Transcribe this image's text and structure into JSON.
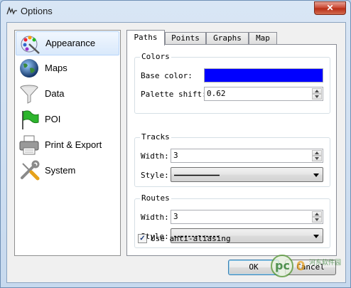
{
  "window": {
    "title": "Options",
    "close_label": "✕"
  },
  "sidebar": {
    "items": [
      {
        "label": "Appearance",
        "icon": "paint-palette-icon",
        "selected": true
      },
      {
        "label": "Maps",
        "icon": "globe-icon",
        "selected": false
      },
      {
        "label": "Data",
        "icon": "funnel-icon",
        "selected": false
      },
      {
        "label": "POI",
        "icon": "green-flag-icon",
        "selected": false
      },
      {
        "label": "Print & Export",
        "icon": "printer-icon",
        "selected": false
      },
      {
        "label": "System",
        "icon": "wrench-screwdriver-icon",
        "selected": false
      }
    ]
  },
  "tabs": [
    {
      "label": "Paths",
      "active": true
    },
    {
      "label": "Points",
      "active": false
    },
    {
      "label": "Graphs",
      "active": false
    },
    {
      "label": "Map",
      "active": false
    }
  ],
  "colors_group": {
    "title": "Colors",
    "base_color_label": "Base color:",
    "base_color_value": "#0000ff",
    "palette_shift_label": "Palette shift:",
    "palette_shift_value": "0.62"
  },
  "tracks_group": {
    "title": "Tracks",
    "width_label": "Width:",
    "width_value": "3",
    "style_label": "Style:",
    "style_value": "solid"
  },
  "routes_group": {
    "title": "Routes",
    "width_label": "Width:",
    "width_value": "3",
    "style_label": "Style:",
    "style_value": "dashed"
  },
  "anti_aliasing": {
    "label": "Use anti-aliasing",
    "checked": true
  },
  "buttons": {
    "ok_label": "OK",
    "cancel_label": "Cancel"
  },
  "watermark": {
    "text": "pc0",
    "subtext": "河东软件园"
  }
}
